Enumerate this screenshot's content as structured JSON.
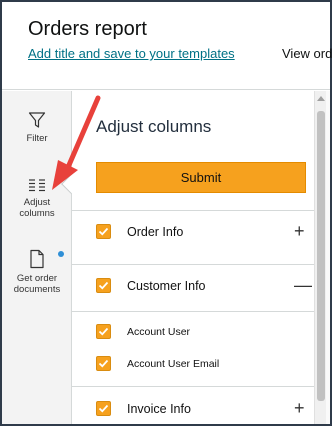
{
  "header": {
    "title": "Orders report",
    "add_title_link": "Add title and save to your templates",
    "view_link": "View orde"
  },
  "sidebar": {
    "items": [
      {
        "label": "Filter",
        "icon": "filter-icon"
      },
      {
        "label": "Adjust columns",
        "icon": "columns-icon"
      },
      {
        "label": "Get order documents",
        "icon": "document-icon"
      }
    ]
  },
  "panel": {
    "title": "Adjust columns",
    "submit_label": "Submit",
    "groups": [
      {
        "label": "Order Info",
        "checked": true,
        "toggle": "+"
      },
      {
        "label": "Customer Info",
        "checked": true,
        "toggle": "—"
      },
      {
        "label": "Account User",
        "checked": true
      },
      {
        "label": "Account User Email",
        "checked": true
      },
      {
        "label": "Invoice Info",
        "checked": true,
        "toggle": "+"
      }
    ]
  },
  "colors": {
    "accent": "#f6a11e",
    "link": "#007185",
    "annotation_arrow": "#e8413b",
    "notification_dot": "#2f8fd6"
  }
}
